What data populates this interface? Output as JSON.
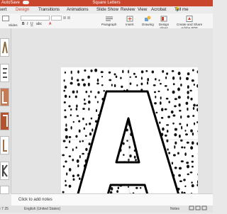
{
  "titlebar": {
    "autosave": "AutoSave",
    "autosave_state": "OFF",
    "title": "Square Letters"
  },
  "tabs": [
    "Insert",
    "Design",
    "Transitions",
    "Animations",
    "Slide Show",
    "Review",
    "View",
    "Acrobat",
    "Tell me"
  ],
  "active_tab": "Design",
  "ribbon": {
    "slides": "Slides",
    "paragraph": "Paragraph",
    "insert": "Insert",
    "drawing": "Drawing",
    "design_ideas": "Design Ideas",
    "create_share": "Create and Share Adobe PDF"
  },
  "notes_placeholder": "Click to add notes",
  "status": {
    "slide": "e 7 25",
    "language": "English (United States)",
    "zoom": "Notes"
  },
  "colors": {
    "accent": "#c9452b",
    "slide_bg": "#ffffff",
    "dots": "#111111"
  },
  "slide": {
    "letter": "A"
  }
}
